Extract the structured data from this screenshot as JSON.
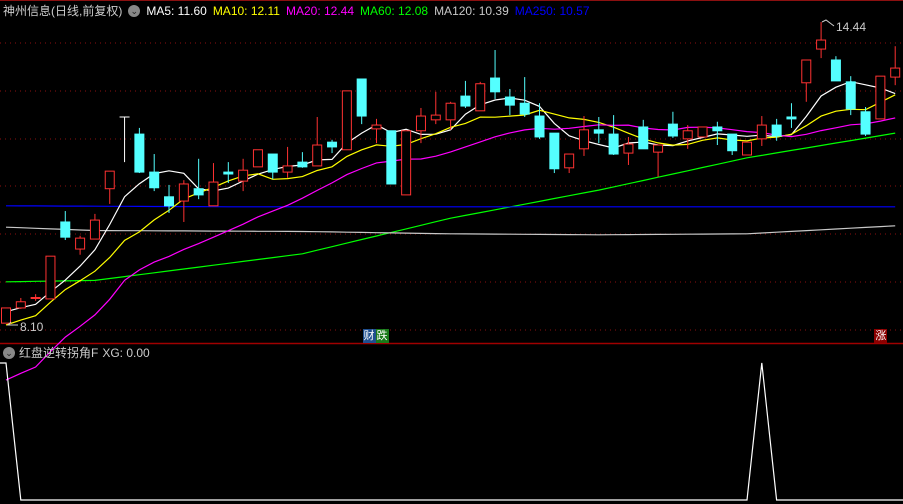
{
  "header": {
    "title": "神州信息(日线,前复权)",
    "ma": [
      {
        "label": "MA5: 11.60",
        "color": "#ffffff"
      },
      {
        "label": "MA10: 12.11",
        "color": "#ffff00"
      },
      {
        "label": "MA20: 12.44",
        "color": "#ff00ff"
      },
      {
        "label": "MA60: 12.08",
        "color": "#00ff00"
      },
      {
        "label": "MA120: 10.39",
        "color": "#c8c8c8"
      },
      {
        "label": "MA250: 10.57",
        "color": "#0000ff"
      }
    ]
  },
  "indicator": {
    "title": "红盘逆转拐角F",
    "value_label": "XG: 0.00"
  },
  "signals": [
    {
      "text": "财",
      "index": 25,
      "bg": "#1f4f8f",
      "offset": -8
    },
    {
      "text": "跌",
      "index": 25,
      "bg": "#1a7a1a",
      "offset": 5
    },
    {
      "text": "涨",
      "index": 59,
      "bg": "#8b0000",
      "offset": 0
    }
  ],
  "chart_data": {
    "type": "candlestick",
    "title": "神州信息(日线,前复权)",
    "high_label": "14.44",
    "low_label": "8.10",
    "ylim": [
      8.0,
      14.6
    ],
    "colors": {
      "up": "#ff3232",
      "down": "#54ffff",
      "doji": "#ffffff"
    },
    "candles_ohlc": [
      [
        8.1,
        8.42,
        8.1,
        8.42
      ],
      [
        8.42,
        8.63,
        8.4,
        8.55
      ],
      [
        8.63,
        8.71,
        8.57,
        8.64
      ],
      [
        8.61,
        9.51,
        8.61,
        9.51
      ],
      [
        10.23,
        10.46,
        9.85,
        9.91
      ],
      [
        9.66,
        9.94,
        9.54,
        9.89
      ],
      [
        9.87,
        10.4,
        9.87,
        10.27
      ],
      [
        10.93,
        11.3,
        10.61,
        11.3
      ],
      [
        12.44,
        12.44,
        11.49,
        12.44
      ],
      [
        12.08,
        12.21,
        11.26,
        11.28
      ],
      [
        11.28,
        11.66,
        10.88,
        10.95
      ],
      [
        10.76,
        11.01,
        10.42,
        10.57
      ],
      [
        10.67,
        11.11,
        10.23,
        11.03
      ],
      [
        10.93,
        11.56,
        10.71,
        10.8
      ],
      [
        10.57,
        11.47,
        10.57,
        11.07
      ],
      [
        11.28,
        11.49,
        11.05,
        11.24
      ],
      [
        11.09,
        11.56,
        10.88,
        11.32
      ],
      [
        11.39,
        11.75,
        11.39,
        11.75
      ],
      [
        11.66,
        11.66,
        11.13,
        11.28
      ],
      [
        11.28,
        11.81,
        11.16,
        11.41
      ],
      [
        11.49,
        11.7,
        11.37,
        11.39
      ],
      [
        11.41,
        12.44,
        11.41,
        11.85
      ],
      [
        11.91,
        11.96,
        11.68,
        11.81
      ],
      [
        11.75,
        12.99,
        11.75,
        12.99
      ],
      [
        13.24,
        13.24,
        12.29,
        12.46
      ],
      [
        12.19,
        12.4,
        11.89,
        12.27
      ],
      [
        12.15,
        12.15,
        11.03,
        11.03
      ],
      [
        10.8,
        12.15,
        10.8,
        12.15
      ],
      [
        12.15,
        12.63,
        11.89,
        12.46
      ],
      [
        12.38,
        12.97,
        12.29,
        12.48
      ],
      [
        12.38,
        12.76,
        12.17,
        12.73
      ],
      [
        12.88,
        13.2,
        12.63,
        12.67
      ],
      [
        12.57,
        13.18,
        12.57,
        13.14
      ],
      [
        13.26,
        13.85,
        12.82,
        12.97
      ],
      [
        12.86,
        13.03,
        12.48,
        12.69
      ],
      [
        12.73,
        13.28,
        12.44,
        12.5
      ],
      [
        12.46,
        12.73,
        11.98,
        12.02
      ],
      [
        12.1,
        12.1,
        11.26,
        11.35
      ],
      [
        11.37,
        11.66,
        11.26,
        11.66
      ],
      [
        11.77,
        12.46,
        11.62,
        12.17
      ],
      [
        12.17,
        12.44,
        11.89,
        12.1
      ],
      [
        12.08,
        12.48,
        11.64,
        11.66
      ],
      [
        11.68,
        12.02,
        11.43,
        11.87
      ],
      [
        12.23,
        12.38,
        11.77,
        11.77
      ],
      [
        11.7,
        11.85,
        11.18,
        11.85
      ],
      [
        12.29,
        12.55,
        12.0,
        12.04
      ],
      [
        11.98,
        12.27,
        11.77,
        12.15
      ],
      [
        12.02,
        12.23,
        12.02,
        12.23
      ],
      [
        12.23,
        12.34,
        11.85,
        12.15
      ],
      [
        12.08,
        12.08,
        11.64,
        11.73
      ],
      [
        11.64,
        11.91,
        11.64,
        11.91
      ],
      [
        11.98,
        12.46,
        11.83,
        12.27
      ],
      [
        12.27,
        12.4,
        11.94,
        12.04
      ],
      [
        12.44,
        12.73,
        12.21,
        12.4
      ],
      [
        13.16,
        13.64,
        12.76,
        13.64
      ],
      [
        13.87,
        14.44,
        13.68,
        14.06
      ],
      [
        13.64,
        13.72,
        13.2,
        13.2
      ],
      [
        13.18,
        13.3,
        12.48,
        12.61
      ],
      [
        12.55,
        12.65,
        12.04,
        12.08
      ],
      [
        12.4,
        13.3,
        12.4,
        13.3
      ],
      [
        13.28,
        13.93,
        13.11,
        13.47
      ]
    ],
    "moving_averages_computed": [
      {
        "name": "MA5",
        "period": 5,
        "color": "#ffffff"
      },
      {
        "name": "MA10",
        "period": 10,
        "color": "#ffff00"
      },
      {
        "name": "MA20",
        "period": 20,
        "color": "#ff00ff"
      }
    ],
    "moving_averages_sampled": [
      {
        "name": "MA60",
        "color": "#00ff00",
        "index": [
          0,
          6,
          20,
          30,
          40,
          50,
          60
        ],
        "values": [
          8.97,
          9.0,
          9.56,
          10.31,
          10.9,
          11.58,
          12.1
        ]
      },
      {
        "name": "MA120",
        "color": "#c8c8c8",
        "index": [
          0,
          6,
          20,
          30,
          40,
          50,
          60
        ],
        "values": [
          10.12,
          10.05,
          10.03,
          9.98,
          9.96,
          9.98,
          10.15
        ]
      },
      {
        "name": "MA250",
        "color": "#0000ff",
        "index": [
          0,
          15,
          30,
          45,
          60
        ],
        "values": [
          10.57,
          10.55,
          10.55,
          10.55,
          10.55
        ]
      }
    ],
    "indicator_series": {
      "name": "XG",
      "values_nonzero_index": [
        0,
        51
      ],
      "ylim": [
        0,
        1
      ]
    }
  }
}
